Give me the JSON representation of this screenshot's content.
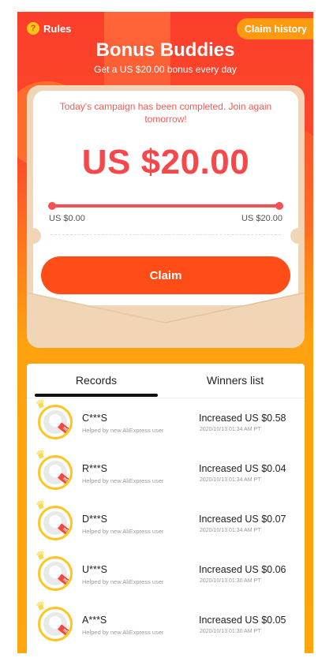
{
  "header": {
    "rules_label": "Rules",
    "rules_icon_glyph": "?",
    "claim_history_label": "Claim history",
    "title": "Bonus Buddies",
    "subtitle": "Get a US $20.00 bonus every day"
  },
  "campaign": {
    "notice": "Today's campaign has been completed. Join again tomorrow!",
    "amount": "US $20.00",
    "progress_fraction": 1.0,
    "range_min": "US $0.00",
    "range_max": "US $20.00",
    "claim_label": "Claim"
  },
  "tabs": [
    {
      "label": "Records",
      "active": true
    },
    {
      "label": "Winners list",
      "active": false
    }
  ],
  "records": [
    {
      "name": "C***S",
      "helped_by": "Helped by new AliExpress user",
      "amount": "Increased US $0.58",
      "time": "2020/10/13 01:34 AM PT"
    },
    {
      "name": "R***S",
      "helped_by": "Helped by new AliExpress user",
      "amount": "Increased US $0.04",
      "time": "2020/10/13 01:34 AM PT"
    },
    {
      "name": "D***S",
      "helped_by": "Helped by new AliExpress user",
      "amount": "Increased US $0.07",
      "time": "2020/10/13 01:34 AM PT"
    },
    {
      "name": "U***S",
      "helped_by": "Helped by new AliExpress user",
      "amount": "Increased US $0.06",
      "time": "2020/10/13 01:30 AM PT"
    },
    {
      "name": "A***S",
      "helped_by": "Helped by new AliExpress user",
      "amount": "Increased US $0.05",
      "time": "2020/10/13 01:30 AM PT"
    }
  ],
  "avatar_badge": "NEW",
  "colors": {
    "brand_red": "#fb3e2b",
    "accent_orange": "#fe4d17",
    "amount_red": "#f6484a",
    "avatar_ring": "#ffc420"
  },
  "icons": {
    "rules": "question-circle-icon",
    "crown": "crown-icon",
    "avatar": "user-avatar-icon"
  }
}
